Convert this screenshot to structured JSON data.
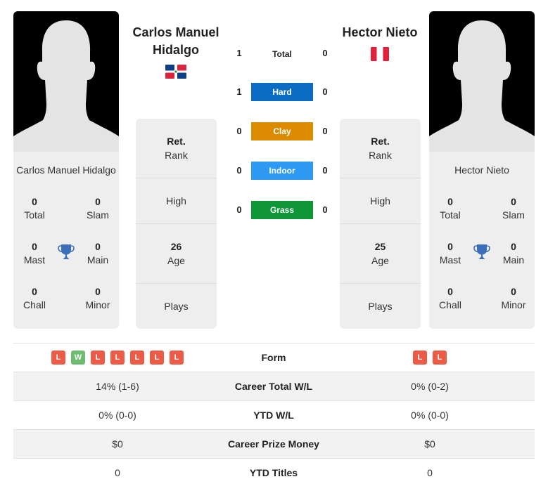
{
  "colors": {
    "hard": "#0a6cc2",
    "clay": "#dc8b00",
    "indoor": "#2e9af3",
    "grass": "#0e9637",
    "loss": "#ec5b45",
    "win": "#6fbb71",
    "trophy": "#3b6fba"
  },
  "player1": {
    "name": "Carlos Manuel Hidalgo",
    "photo_name": "Carlos Manuel Hidalgo",
    "flag": "dominican-republic-flag",
    "titles": {
      "total": {
        "value": "0",
        "label": "Total"
      },
      "slam": {
        "value": "0",
        "label": "Slam"
      },
      "mast": {
        "value": "0",
        "label": "Mast"
      },
      "main": {
        "value": "0",
        "label": "Main"
      },
      "chall": {
        "value": "0",
        "label": "Chall"
      },
      "minor": {
        "value": "0",
        "label": "Minor"
      }
    },
    "info": {
      "rank": {
        "value": "Ret.",
        "label": "Rank"
      },
      "high": {
        "value": "",
        "label": "High"
      },
      "age": {
        "value": "26",
        "label": "Age"
      },
      "plays": {
        "value": "",
        "label": "Plays"
      }
    }
  },
  "player2": {
    "name": "Hector Nieto",
    "photo_name": "Hector Nieto",
    "flag": "peru-flag",
    "titles": {
      "total": {
        "value": "0",
        "label": "Total"
      },
      "slam": {
        "value": "0",
        "label": "Slam"
      },
      "mast": {
        "value": "0",
        "label": "Mast"
      },
      "main": {
        "value": "0",
        "label": "Main"
      },
      "chall": {
        "value": "0",
        "label": "Chall"
      },
      "minor": {
        "value": "0",
        "label": "Minor"
      }
    },
    "info": {
      "rank": {
        "value": "Ret.",
        "label": "Rank"
      },
      "high": {
        "value": "",
        "label": "High"
      },
      "age": {
        "value": "25",
        "label": "Age"
      },
      "plays": {
        "value": "",
        "label": "Plays"
      }
    }
  },
  "h2h": [
    {
      "label": "Total",
      "p1": "1",
      "p2": "0"
    },
    {
      "label": "Hard",
      "p1": "1",
      "p2": "0"
    },
    {
      "label": "Clay",
      "p1": "0",
      "p2": "0"
    },
    {
      "label": "Indoor",
      "p1": "0",
      "p2": "0"
    },
    {
      "label": "Grass",
      "p1": "0",
      "p2": "0"
    }
  ],
  "comparison": {
    "form": {
      "label": "Form",
      "p1": [
        "L",
        "W",
        "L",
        "L",
        "L",
        "L",
        "L"
      ],
      "p2": [
        "L",
        "L"
      ]
    },
    "rows": [
      {
        "label": "Career Total W/L",
        "p1": "14% (1-6)",
        "p2": "0% (0-2)"
      },
      {
        "label": "YTD W/L",
        "p1": "0% (0-0)",
        "p2": "0% (0-0)"
      },
      {
        "label": "Career Prize Money",
        "p1": "$0",
        "p2": "$0"
      },
      {
        "label": "YTD Titles",
        "p1": "0",
        "p2": "0"
      }
    ]
  }
}
